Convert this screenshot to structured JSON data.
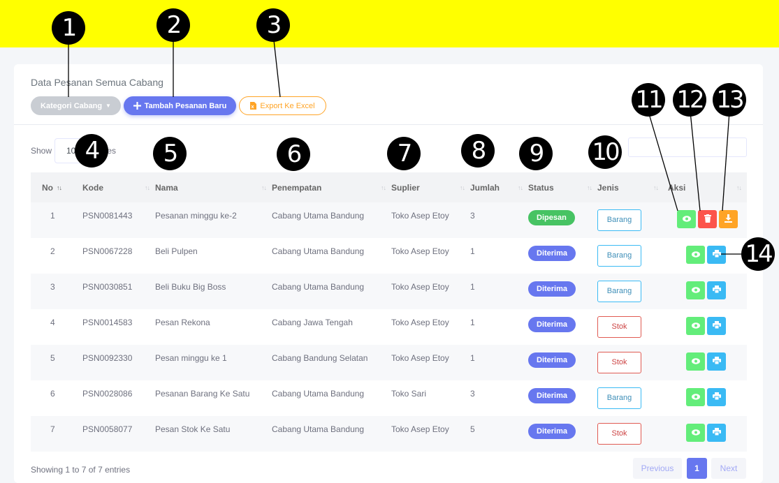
{
  "page": {
    "title": "Data Pesanan Semua Cabang",
    "buttons": {
      "kategori": "Kategori Cabang",
      "tambah": "Tambah Pesanan Baru",
      "export": "Export Ke Excel"
    },
    "length": {
      "show": "Show",
      "value": "10",
      "entries": "entries"
    },
    "search": {
      "value": ""
    }
  },
  "table": {
    "headers": [
      "No",
      "Kode",
      "Nama",
      "Penempatan",
      "Suplier",
      "Jumlah",
      "Status",
      "Jenis",
      "Aksi"
    ],
    "rows": [
      {
        "no": "1",
        "kode": "PSN0081443",
        "nama": "Pesanan minggu ke-2",
        "penempatan": "Cabang Utama Bandung",
        "suplier": "Toko Asep Etoy",
        "jumlah": "3",
        "status": "Dipesan",
        "jenis": "Barang"
      },
      {
        "no": "2",
        "kode": "PSN0067228",
        "nama": "Beli Pulpen",
        "penempatan": "Cabang Utama Bandung",
        "suplier": "Toko Asep Etoy",
        "jumlah": "1",
        "status": "Diterima",
        "jenis": "Barang"
      },
      {
        "no": "3",
        "kode": "PSN0030851",
        "nama": "Beli Buku Big Boss",
        "penempatan": "Cabang Utama Bandung",
        "suplier": "Toko Asep Etoy",
        "jumlah": "1",
        "status": "Diterima",
        "jenis": "Barang"
      },
      {
        "no": "4",
        "kode": "PSN0014583",
        "nama": "Pesan Rekona",
        "penempatan": "Cabang Jawa Tengah",
        "suplier": "Toko Asep Etoy",
        "jumlah": "1",
        "status": "Diterima",
        "jenis": "Stok"
      },
      {
        "no": "5",
        "kode": "PSN0092330",
        "nama": "Pesan minggu ke 1",
        "penempatan": "Cabang Bandung Selatan",
        "suplier": "Toko Asep Etoy",
        "jumlah": "1",
        "status": "Diterima",
        "jenis": "Stok"
      },
      {
        "no": "6",
        "kode": "PSN0028086",
        "nama": "Pesanan Barang Ke Satu",
        "penempatan": "Cabang Utama Bandung",
        "suplier": "Toko Sari",
        "jumlah": "3",
        "status": "Diterima",
        "jenis": "Barang"
      },
      {
        "no": "7",
        "kode": "PSN0058077",
        "nama": "Pesan Stok Ke Satu",
        "penempatan": "Cabang Utama Bandung",
        "suplier": "Toko Asep Etoy",
        "jumlah": "5",
        "status": "Diterima",
        "jenis": "Stok"
      }
    ]
  },
  "footer": {
    "showing": "Showing 1 to 7 of 7 entries",
    "previous": "Previous",
    "page": "1",
    "next": "Next"
  },
  "callouts": [
    "1",
    "2",
    "3",
    "4",
    "5",
    "6",
    "7",
    "8",
    "9",
    "10",
    "11",
    "12",
    "13",
    "14"
  ],
  "colors": {
    "highlight": "#ffff00",
    "primary": "#6777ef",
    "success": "#63ed7a",
    "danger": "#fc544b",
    "warning": "#ffa426",
    "info": "#3abaf4"
  }
}
